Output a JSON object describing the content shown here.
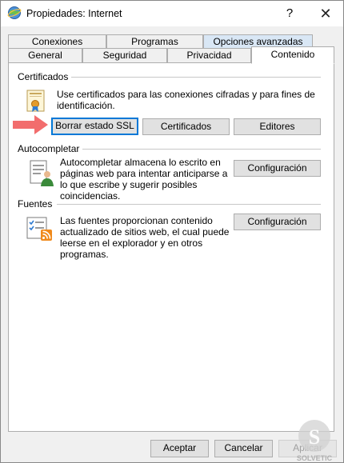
{
  "window": {
    "title": "Propiedades: Internet",
    "help_label": "?",
    "close_label": "✕"
  },
  "tabs": {
    "row1": [
      "Conexiones",
      "Programas",
      "Opciones avanzadas"
    ],
    "row2": [
      "General",
      "Seguridad",
      "Privacidad",
      "Contenido"
    ],
    "active": "Contenido"
  },
  "certificates": {
    "label": "Certificados",
    "description_line1": "Use certificados para las conexiones cifradas y para fines de",
    "description_line2": "identificación.",
    "clear_ssl": "Borrar estado SSL",
    "certificates_button": "Certificados",
    "publishers": "Editores"
  },
  "autocomplete": {
    "label": "Autocompletar",
    "description_lines": [
      "Autocompletar almacena lo escrito en",
      "páginas web para intentar anticiparse a",
      "lo que escribe y sugerir posibles",
      "coincidencias."
    ],
    "settings_button": "Configuración"
  },
  "feeds": {
    "label": "Fuentes",
    "description_lines": [
      "Las fuentes proporcionan contenido",
      "actualizado de sitios web, el cual puede",
      "leerse en el explorador y en otros",
      "programas."
    ],
    "settings_button": "Configuración"
  },
  "footer": {
    "ok": "Aceptar",
    "cancel": "Cancelar",
    "apply": "Aplicar"
  },
  "watermark_text": "SOLVETIC",
  "colors": {
    "accent": "#0078d7",
    "arrow": "#f26d6d",
    "tab_highlight": "#d9e7f5"
  }
}
